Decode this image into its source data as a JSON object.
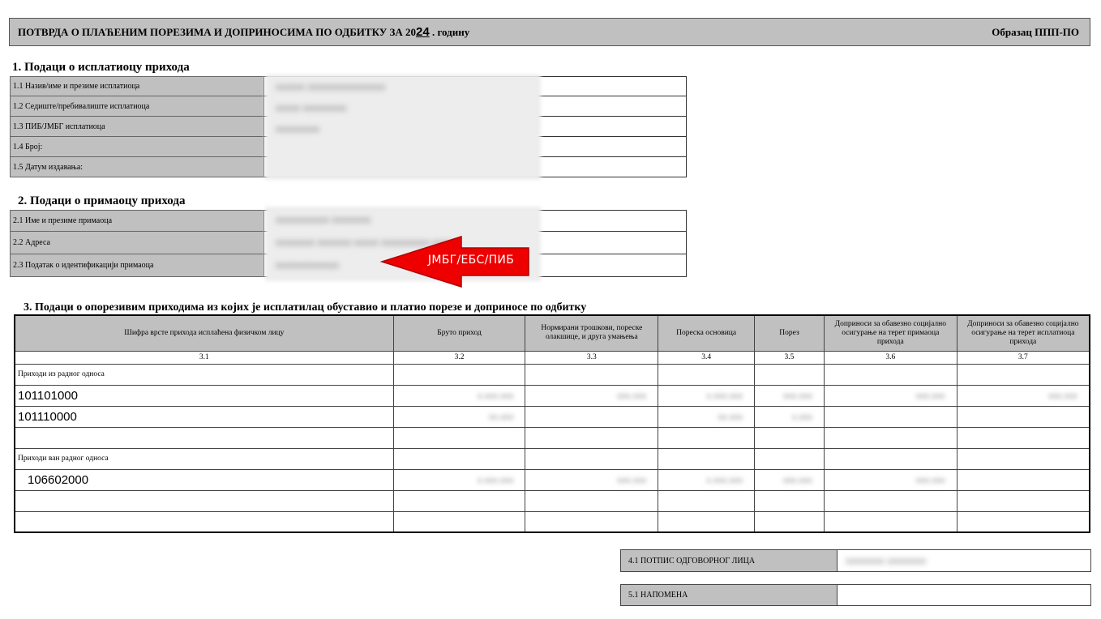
{
  "header": {
    "title_prefix": "ПОТВРДА О ПЛАЋЕНИМ ПОРЕЗИМА И ДОПРИНОСИМА ПО ОДБИТКУ ЗА 20",
    "title_year": "24",
    "title_suffix": " . годину",
    "form_name": "Образац ППП-ПО"
  },
  "section1": {
    "title": "1. Подаци о исплатиоцу прихода",
    "rows": [
      {
        "label": "1.1 Назив/име и презиме исплатиоца",
        "value": "xxxxxx xxxxxxxxxxxxxxxx"
      },
      {
        "label": "1.2 Седиште/пребивалиште исплатиоца",
        "value": "xxxxx xxxxxxxxx"
      },
      {
        "label": "1.3 ПИБ/ЈМБГ исплатиоца",
        "value": "xxxxxxxxx"
      },
      {
        "label": "1.4 Број:",
        "value": ""
      },
      {
        "label": "1.5 Датум издавања:",
        "value": ""
      }
    ]
  },
  "section2": {
    "title": "2. Подаци о примаоцу прихода",
    "rows": [
      {
        "label": "2.1 Име и презиме примаоца",
        "value": "xxxxxxxxxxx xxxxxxxx"
      },
      {
        "label": "2.2 Адреса",
        "value": "xxxxxxxx xxxxxxx xxxxx xxxxxxxxxx xxxx"
      },
      {
        "label": "2.3 Податак о идентификацији примаоца",
        "value": "xxxxxxxxxxxxx"
      }
    ],
    "callout": "ЈМБГ/ЕБС/ПИБ"
  },
  "section3": {
    "title": "3. Подаци о опорезивим приходима из којих је исплатилац обуставио и платио порезе и доприносе по одбитку",
    "columns": [
      "Шифра врсте прихода исплаћена физичком лицу",
      "Бруто приход",
      "Нормирани трошкови, пореске олакшице, и друга умањења",
      "Пореска основица",
      "Порез",
      "Доприноси за обавезно социјално осигурање на терет примаоца прихода",
      "Доприноси за обавезно социјално осигурање на терет исплатиоца прихода"
    ],
    "column_numbers": [
      "3.1",
      "3.2",
      "3.3",
      "3.4",
      "3.5",
      "3.6",
      "3.7"
    ],
    "group1": "Приходи из радног односа",
    "group2": "Приходи ван радног односа",
    "codes": [
      "101101000",
      "101110000",
      "106602000"
    ]
  },
  "section4": {
    "signature_label": "4.1 ПОТПИС ОДГОВОРНОГ ЛИЦА",
    "signature_value": "xxxxxxxx xxxxxxxx"
  },
  "section5": {
    "note_label": "5.1 НАПОМЕНА"
  },
  "colors": {
    "label_bg": "#c0c0c0",
    "callout_red": "#ee0000"
  }
}
